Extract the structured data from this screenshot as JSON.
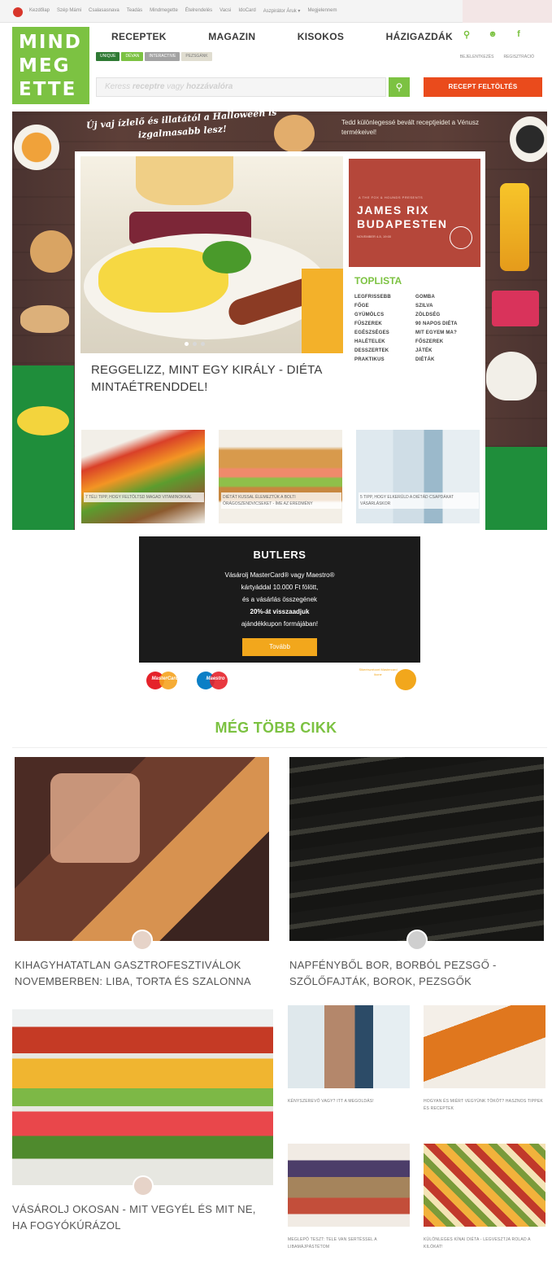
{
  "topbar": {
    "links": [
      "Kezdőlap",
      "Szép Mámi",
      "Csalasasnava",
      "Teadás",
      "Mindmegette",
      "Ételrendelés",
      "Vacsi",
      "IdoCard",
      "Aszpirátor Áruk ▾",
      "Megjelennem"
    ]
  },
  "logo": {
    "line1": "MIND",
    "line2": "MEG",
    "line3": "ETTE"
  },
  "nav": {
    "items": [
      "RECEPTEK",
      "MAGAZIN",
      "KISOKOS",
      "HÁZIGAZDÁK"
    ],
    "icons": [
      "search-icon",
      "user-icon",
      "facebook-icon"
    ],
    "icon_glyphs": [
      "⚲",
      "☻",
      "f"
    ]
  },
  "subnav": {
    "pills": [
      {
        "label": "UNIQUE",
        "color": "#2f7a34"
      },
      {
        "label": "DÉVAN",
        "color": "#7cc242"
      },
      {
        "label": "INTERACTIVE",
        "color": "#a3a3a3"
      },
      {
        "label": "PEZSGÁNK",
        "color": "#e0ddd0"
      }
    ]
  },
  "account": {
    "login": "BEJELENTKEZÉS",
    "register": "REGISZTRÁCIÓ"
  },
  "search": {
    "placeholder_parts": [
      "Keress ",
      "receptre",
      " vagy ",
      "hozzávalóra"
    ],
    "button_icon": "search-icon"
  },
  "upload_button": "RECEPT FELTÖLTÉS",
  "hero": {
    "slogan": "Új vaj ízlelő és illatától a Halloween is izgalmasabb lesz!",
    "venusz_text": "Tedd különlegessé bevált receptjeidet a Vénusz termékeivel!"
  },
  "featured": {
    "title": "REGGELIZZ, MINT EGY KIRÁLY - DIÉTA MINTAÉTRENDDEL!"
  },
  "adbox": {
    "small": "A THE FOX & HOUNDS PRESENTS",
    "title_line1": "JAMES RIX",
    "title_line2": "BUDAPESTEN",
    "date": "NOVEMBER 4-5, 19:00"
  },
  "toplista": {
    "title": "TOPLISTA",
    "items": [
      "LEGFRISSEBB",
      "GOMBA",
      "FŐGE",
      "SZILVA",
      "GYÜMÖLCS",
      "ZÖLDSÉG",
      "FŰSZEREK",
      "90 NAPOS DIÉTA",
      "EGÉSZSÉGES",
      "MIT EGYEM MA?",
      "HALÉTELEK",
      "FŐSZEREK",
      "DESSZERTEK",
      "JÁTÉK",
      "PRAKTIKUS",
      "DIÉTÁK"
    ]
  },
  "small_cards": [
    {
      "caption": "7 TÉLI TIPP, HOGY FELTÖLTSD MAGAD VITAMINOKKAL"
    },
    {
      "caption": "DIÉTÁT KUSSAL ÉLEMEZTÜK A BOLTI ÖRÁGOSZENDVICSEKET - ÍME AZ EREDMÉNY"
    },
    {
      "caption": "5 TIPP, HOGY ELKERÜLD A DIÉTÁD CSAPDÁKAT VÁSÁRLÁSKOR"
    }
  ],
  "butlers": {
    "name": "BUTLERS",
    "line1": "Vásárolj MasterCard® vagy Maestro®",
    "line2": "kártyáddal 10.000 Ft fölött,",
    "line3": "és a vásárlás összegének",
    "line4": "20%-át visszaadjuk",
    "line5": "ajándékkupon formájában!",
    "button": "Tovább",
    "cards": [
      "MasterCard",
      "Maestro"
    ],
    "sponsor": "Sikerészrézzel Mastercard ikone"
  },
  "more": {
    "title": "MÉG TÖBB CIKK",
    "articles": [
      {
        "title": "KIHAGYHATATLAN GASZTROFESZTIVÁLOK NOVEMBERBEN: LIBA, TORTA ÉS SZALONNA"
      },
      {
        "title": "NAPFÉNYBŐL BOR, BORBÓL PEZSGŐ - SZŐLŐFAJTÁK, BOROK, PEZSGŐK"
      },
      {
        "title": "VÁSÁROLJ OKOSAN - MIT VEGYÉL ÉS MIT NE, HA FOGYÓKÚRÁZOL"
      }
    ],
    "mini": [
      {
        "title": "KÉNYSZEREVŐ VAGY? ITT A MEGOLDÁS!"
      },
      {
        "title": "HOGYAN ÉS MIÉRT VEGYÜNK TÖKÖT? HASZNOS TIPPEK ÉS RECEPTEK"
      },
      {
        "title": "MEGLEPŐ TESZT: TELE VAN SERTÉSSEL A LIBAMÁJPÁSTÉTOM"
      },
      {
        "title": "KÜLÖNLEGES KÍNAI DIÉTA - LEGVESZTJA ROLAD A KILÓKAT!"
      }
    ]
  }
}
